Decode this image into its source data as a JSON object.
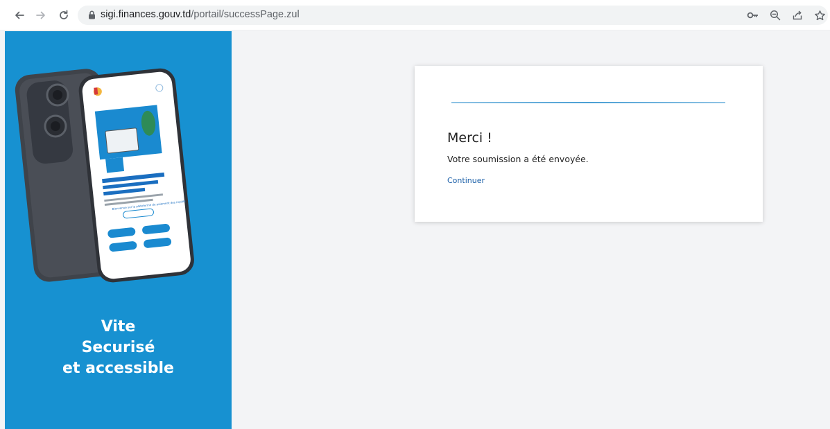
{
  "browser": {
    "url_host": "sigi.finances.gouv.td",
    "url_path": "/portail/successPage.zul"
  },
  "icons": {
    "back": "arrow-left-icon",
    "forward": "arrow-right-icon",
    "reload": "reload-icon",
    "lock": "lock-icon",
    "key": "key-icon",
    "zoom": "zoom-icon",
    "share": "share-icon",
    "bookmark": "star-icon"
  },
  "promo": {
    "line1": "Vite",
    "line2": "Securisé",
    "line3": "et accessible",
    "background_color": "#1791d1"
  },
  "phone_screen": {
    "welcome": "Bienvenue sur la plateforme de paiement des impôts"
  },
  "card": {
    "title": "Merci !",
    "message": "Votre soumission a été envoyée.",
    "link_label": "Continuer",
    "link_color": "#1a5fa8"
  }
}
